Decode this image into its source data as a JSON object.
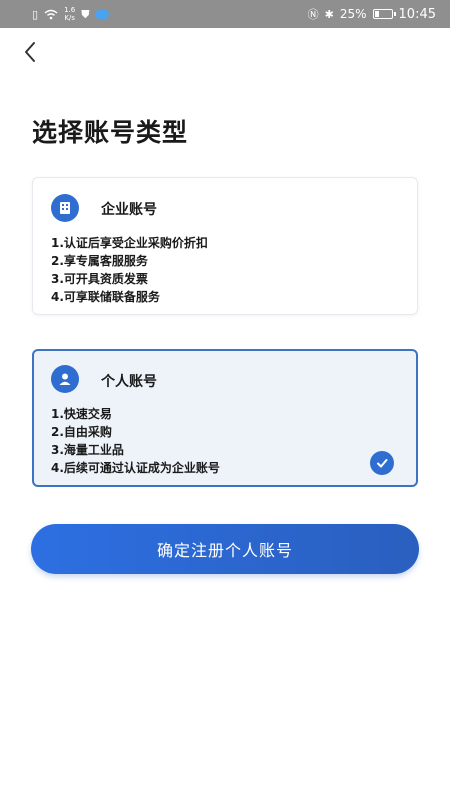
{
  "status_bar": {
    "speed_value": "1.6",
    "speed_unit": "K/s",
    "battery": "25%",
    "time": "10:45"
  },
  "page": {
    "title": "选择账号类型"
  },
  "cards": [
    {
      "title": "企业账号",
      "icon": "building-icon",
      "selected": false,
      "features": [
        "1.认证后享受企业采购价折扣",
        "2.享专属客服服务",
        "3.可开具资质发票",
        "4.可享联储联备服务"
      ]
    },
    {
      "title": "个人账号",
      "icon": "user-icon",
      "selected": true,
      "features": [
        "1.快速交易",
        "2.自由采购",
        "3.海量工业品",
        "4.后续可通过认证成为企业账号"
      ]
    }
  ],
  "confirm_button": {
    "label": "确定注册个人账号"
  },
  "colors": {
    "primary": "#2f6ed0",
    "selected_border": "#3d73c4",
    "selected_background": "#eef3fa",
    "status_bar": "#8f8f8f"
  }
}
